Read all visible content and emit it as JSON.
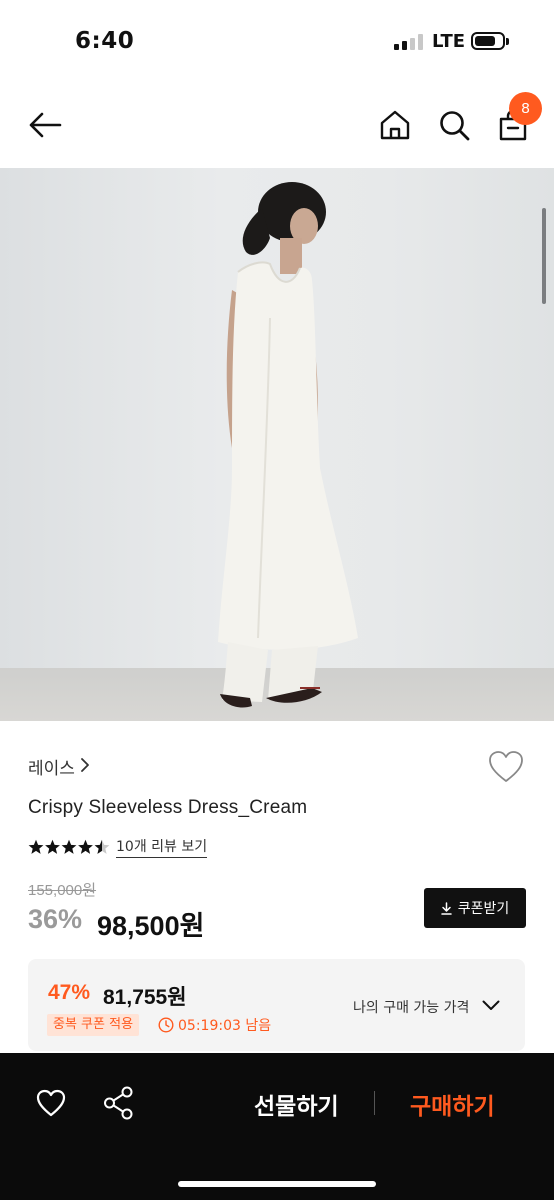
{
  "status_bar": {
    "time": "6:40",
    "network": "LTE"
  },
  "header": {
    "cart_count": "8"
  },
  "product": {
    "brand": "레이스",
    "title": "Crispy Sleeveless Dress_Cream",
    "rating": 4.5,
    "review_link": "10개 리뷰 보기",
    "original_price": "155,000원",
    "discount": "36%",
    "price": "98,500원",
    "coupon_button": "쿠폰받기"
  },
  "best_price": {
    "discount": "47%",
    "price": "81,755원",
    "tag": "중복 쿠폰 적용",
    "timer": "05:19:03 남음",
    "label": "나의 구매 가능 가격"
  },
  "bottom_bar": {
    "gift_label": "선물하기",
    "buy_label": "구매하기"
  },
  "colors": {
    "accent": "#ff5a1f",
    "bar_bg": "#0b0b0b",
    "box_bg": "#f4f4f4"
  },
  "icons": [
    "back-arrow-icon",
    "home-icon",
    "search-icon",
    "shopping-bag-icon",
    "heart-icon",
    "share-icon",
    "star-icon",
    "download-icon",
    "clock-icon",
    "chevron-down-icon"
  ]
}
